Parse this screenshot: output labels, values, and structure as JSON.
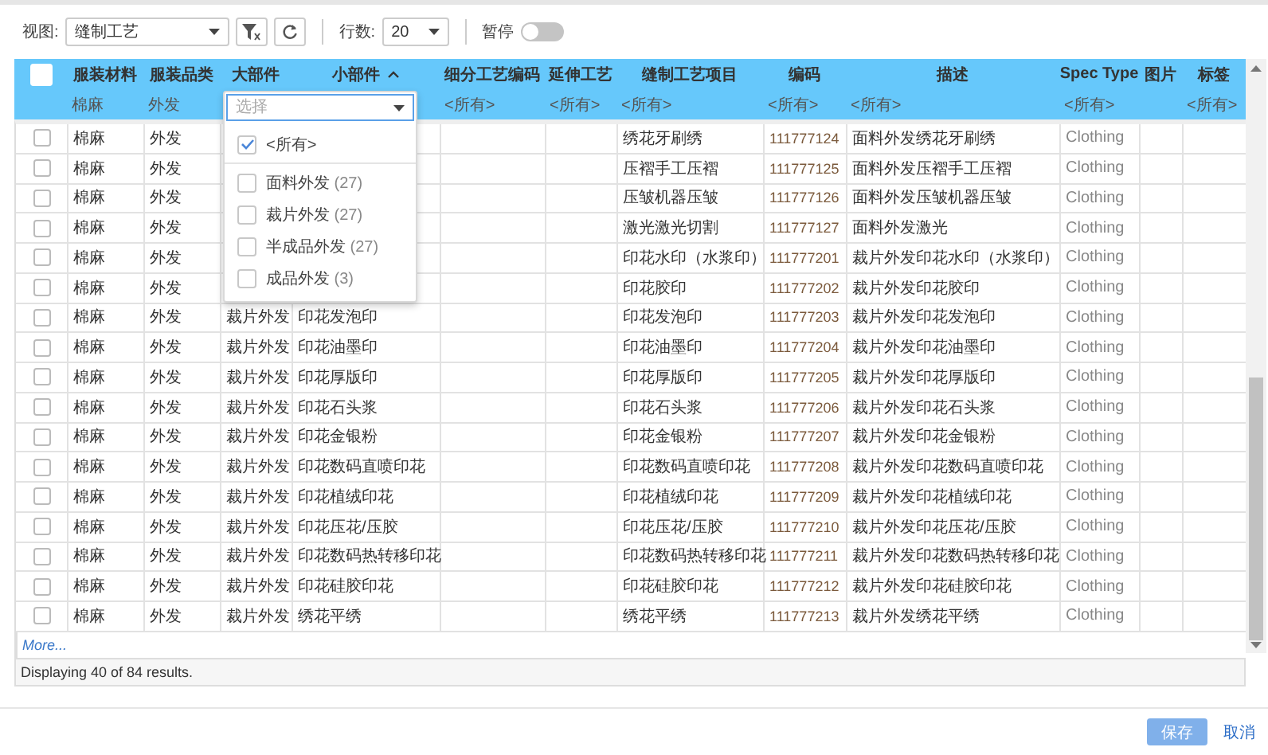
{
  "toolbar": {
    "view_label": "视图:",
    "view_value": "缝制工艺",
    "rows_label": "行数:",
    "rows_value": "20",
    "pause": {
      "label": "暂停",
      "on": false
    }
  },
  "table": {
    "header_checkbox": {
      "checked": false
    },
    "columns": [
      {
        "label": "服装材料",
        "filter": "棉麻",
        "sorted": false
      },
      {
        "label": "服装品类",
        "filter": "外发",
        "sorted": false
      },
      {
        "label": "大部件",
        "sorted": false
      },
      {
        "label": "小部件",
        "sorted": true
      },
      {
        "label": "细分工艺编码",
        "filter": "<所有>",
        "sorted": false
      },
      {
        "label": "延伸工艺",
        "filter": "<所有>",
        "sorted": false
      },
      {
        "label": "缝制工艺项目",
        "filter": "<所有>",
        "sorted": false
      },
      {
        "label": "编码",
        "filter": "<所有>",
        "sorted": false
      },
      {
        "label": "描述",
        "filter": "<所有>",
        "sorted": false
      },
      {
        "label": "Spec Type",
        "filter": "<所有>",
        "sorted": false
      },
      {
        "label": "图片",
        "sorted": false
      },
      {
        "label": "标签",
        "filter": "<所有>",
        "sorted": false
      }
    ],
    "rows": [
      {
        "checked": false,
        "material": "棉麻",
        "category": "外发",
        "craft": "绣花牙刷绣",
        "code": "111777124",
        "description": "面料外发绣花牙刷绣",
        "spec_type": "Clothing"
      },
      {
        "checked": false,
        "material": "棉麻",
        "category": "外发",
        "craft": "压褶手工压褶",
        "code": "111777125",
        "description": "面料外发压褶手工压褶",
        "spec_type": "Clothing"
      },
      {
        "checked": false,
        "material": "棉麻",
        "category": "外发",
        "craft": "压皱机器压皱",
        "code": "111777126",
        "description": "面料外发压皱机器压皱",
        "spec_type": "Clothing"
      },
      {
        "checked": false,
        "material": "棉麻",
        "category": "外发",
        "craft": "激光激光切割",
        "code": "111777127",
        "description": "面料外发激光",
        "spec_type": "Clothing"
      },
      {
        "checked": false,
        "material": "棉麻",
        "category": "外发",
        "craft": "印花水印（水浆印）",
        "code": "111777201",
        "description": "裁片外发印花水印（水浆印）",
        "spec_type": "Clothing"
      },
      {
        "checked": false,
        "material": "棉麻",
        "category": "外发",
        "craft": "印花胶印",
        "code": "111777202",
        "description": "裁片外发印花胶印",
        "spec_type": "Clothing"
      },
      {
        "checked": false,
        "material": "棉麻",
        "category": "外发",
        "major_part": "裁片外发",
        "minor_part": "印花发泡印",
        "craft": "印花发泡印",
        "code": "111777203",
        "description": "裁片外发印花发泡印",
        "spec_type": "Clothing"
      },
      {
        "checked": false,
        "material": "棉麻",
        "category": "外发",
        "major_part": "裁片外发",
        "minor_part": "印花油墨印",
        "craft": "印花油墨印",
        "code": "111777204",
        "description": "裁片外发印花油墨印",
        "spec_type": "Clothing"
      },
      {
        "checked": false,
        "material": "棉麻",
        "category": "外发",
        "major_part": "裁片外发",
        "minor_part": "印花厚版印",
        "craft": "印花厚版印",
        "code": "111777205",
        "description": "裁片外发印花厚版印",
        "spec_type": "Clothing"
      },
      {
        "checked": false,
        "material": "棉麻",
        "category": "外发",
        "major_part": "裁片外发",
        "minor_part": "印花石头浆",
        "craft": "印花石头浆",
        "code": "111777206",
        "description": "裁片外发印花石头浆",
        "spec_type": "Clothing"
      },
      {
        "checked": false,
        "material": "棉麻",
        "category": "外发",
        "major_part": "裁片外发",
        "minor_part": "印花金银粉",
        "craft": "印花金银粉",
        "code": "111777207",
        "description": "裁片外发印花金银粉",
        "spec_type": "Clothing"
      },
      {
        "checked": false,
        "material": "棉麻",
        "category": "外发",
        "major_part": "裁片外发",
        "minor_part": "印花数码直喷印花",
        "craft": "印花数码直喷印花",
        "code": "111777208",
        "description": "裁片外发印花数码直喷印花",
        "spec_type": "Clothing"
      },
      {
        "checked": false,
        "material": "棉麻",
        "category": "外发",
        "major_part": "裁片外发",
        "minor_part": "印花植绒印花",
        "craft": "印花植绒印花",
        "code": "111777209",
        "description": "裁片外发印花植绒印花",
        "spec_type": "Clothing"
      },
      {
        "checked": false,
        "material": "棉麻",
        "category": "外发",
        "major_part": "裁片外发",
        "minor_part": "印花压花/压胶",
        "craft": "印花压花/压胶",
        "code": "111777210",
        "description": "裁片外发印花压花/压胶",
        "spec_type": "Clothing"
      },
      {
        "checked": false,
        "material": "棉麻",
        "category": "外发",
        "major_part": "裁片外发",
        "minor_part": "印花数码热转移印花",
        "craft": "印花数码热转移印花",
        "code": "111777211",
        "description": "裁片外发印花数码热转移印花",
        "spec_type": "Clothing"
      },
      {
        "checked": false,
        "material": "棉麻",
        "category": "外发",
        "major_part": "裁片外发",
        "minor_part": "印花硅胶印花",
        "craft": "印花硅胶印花",
        "code": "111777212",
        "description": "裁片外发印花硅胶印花",
        "spec_type": "Clothing"
      },
      {
        "checked": false,
        "material": "棉麻",
        "category": "外发",
        "major_part": "裁片外发",
        "minor_part": "绣花平绣",
        "craft": "绣花平绣",
        "code": "111777213",
        "description": "裁片外发绣花平绣",
        "spec_type": "Clothing"
      }
    ],
    "more_link": "More...",
    "status": "Displaying 40 of 84 results."
  },
  "filter_dropdown": {
    "placeholder": "选择",
    "options": [
      {
        "kind": "all",
        "label": "<所有>",
        "checked": true
      },
      {
        "kind": "value",
        "label": "面料外发",
        "count": "(27)",
        "checked": false
      },
      {
        "kind": "value",
        "label": "裁片外发",
        "count": "(27)",
        "checked": false
      },
      {
        "kind": "value",
        "label": "半成品外发",
        "count": "(27)",
        "checked": false
      },
      {
        "kind": "value",
        "label": "成品外发",
        "count": "(3)",
        "checked": false
      }
    ]
  },
  "buttons": [
    {
      "label": "保存",
      "kind": "primary",
      "disabled": true
    },
    {
      "label": "取消",
      "kind": "link",
      "disabled": false
    }
  ]
}
